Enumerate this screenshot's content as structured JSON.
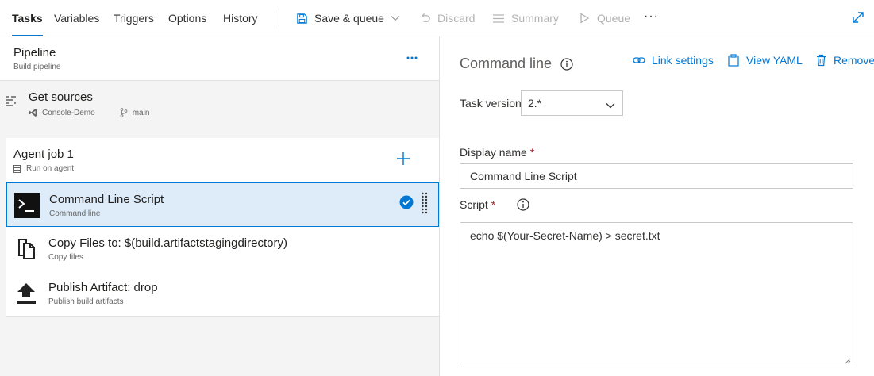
{
  "toolbar": {
    "tabs": [
      {
        "label": "Tasks",
        "active": true
      },
      {
        "label": "Variables",
        "active": false
      },
      {
        "label": "Triggers",
        "active": false
      },
      {
        "label": "Options",
        "active": false
      },
      {
        "label": "History",
        "active": false
      }
    ],
    "actions": {
      "save_queue": "Save & queue",
      "discard": "Discard",
      "summary": "Summary",
      "queue": "Queue",
      "more": "···"
    }
  },
  "pipeline": {
    "title": "Pipeline",
    "subtitle": "Build pipeline",
    "more": "···"
  },
  "get_sources": {
    "title": "Get sources",
    "repo": "Console-Demo",
    "branch": "main"
  },
  "agent_job": {
    "title": "Agent job 1",
    "subtitle": "Run on agent"
  },
  "tasks": [
    {
      "title": "Command Line Script",
      "subtitle": "Command line",
      "selected": true
    },
    {
      "title": "Copy Files to: $(build.artifactstagingdirectory)",
      "subtitle": "Copy files",
      "selected": false
    },
    {
      "title": "Publish Artifact: drop",
      "subtitle": "Publish build artifacts",
      "selected": false
    }
  ],
  "details": {
    "title": "Command line",
    "links": {
      "link_settings": "Link settings",
      "view_yaml": "View YAML",
      "remove": "Remove"
    },
    "task_version_label": "Task version",
    "task_version_value": "2.*",
    "display_name_label": "Display name",
    "display_name_value": "Command Line Script",
    "script_label": "Script",
    "script_value": "echo $(Your-Secret-Name) > secret.txt",
    "required_marker": "*"
  },
  "colors": {
    "accent": "#0078d4",
    "selected_bg": "#deecf9",
    "required": "#a4262c",
    "disabled": "#b3b3b3"
  }
}
